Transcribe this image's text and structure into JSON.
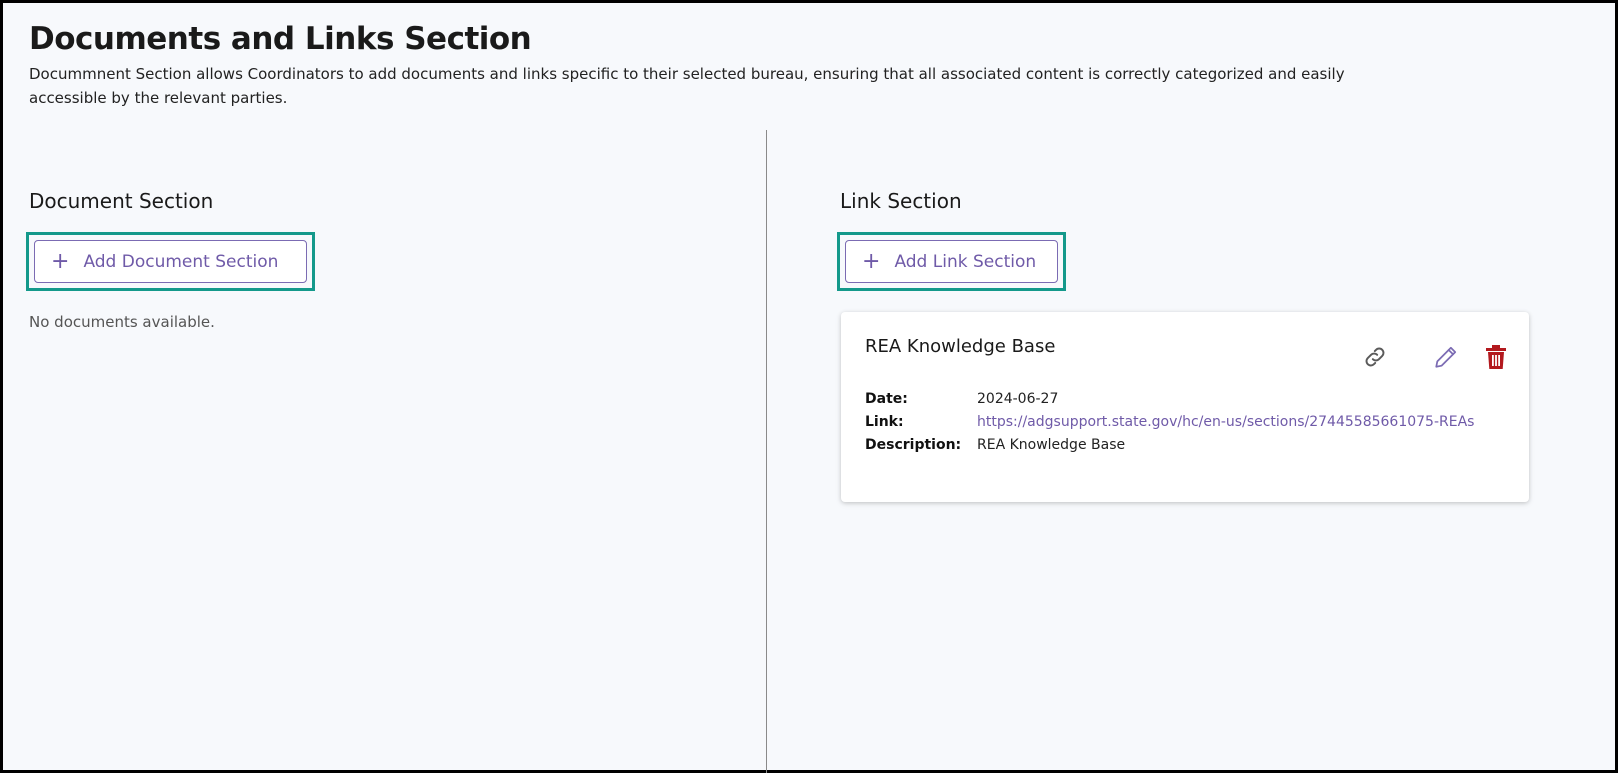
{
  "page": {
    "title": "Documents and Links Section",
    "description": "Docummnent Section allows Coordinators to add documents and links specific to their selected bureau, ensuring that all associated content is correctly categorized and easily accessible by the relevant parties."
  },
  "document_section": {
    "title": "Document Section",
    "add_button_label": "Add Document Section",
    "add_button_icon": "plus-icon",
    "empty_message": "No documents available."
  },
  "link_section": {
    "title": "Link Section",
    "add_button_label": "Add Link Section",
    "add_button_icon": "plus-icon",
    "cards": [
      {
        "title": "REA Knowledge Base",
        "date_label": "Date:",
        "date": "2024-06-27",
        "link_label": "Link:",
        "link": "https://adgsupport.state.gov/hc/en-us/sections/27445585661075-REAs",
        "description_label": "Description:",
        "description": "REA Knowledge Base",
        "actions": [
          "link-icon",
          "edit-icon",
          "delete-icon"
        ]
      }
    ]
  },
  "colors": {
    "page_background": "#f7f9fc",
    "accent_purple": "#6f5aa8",
    "highlight_teal": "#14998b",
    "delete_red": "#b3191e"
  }
}
